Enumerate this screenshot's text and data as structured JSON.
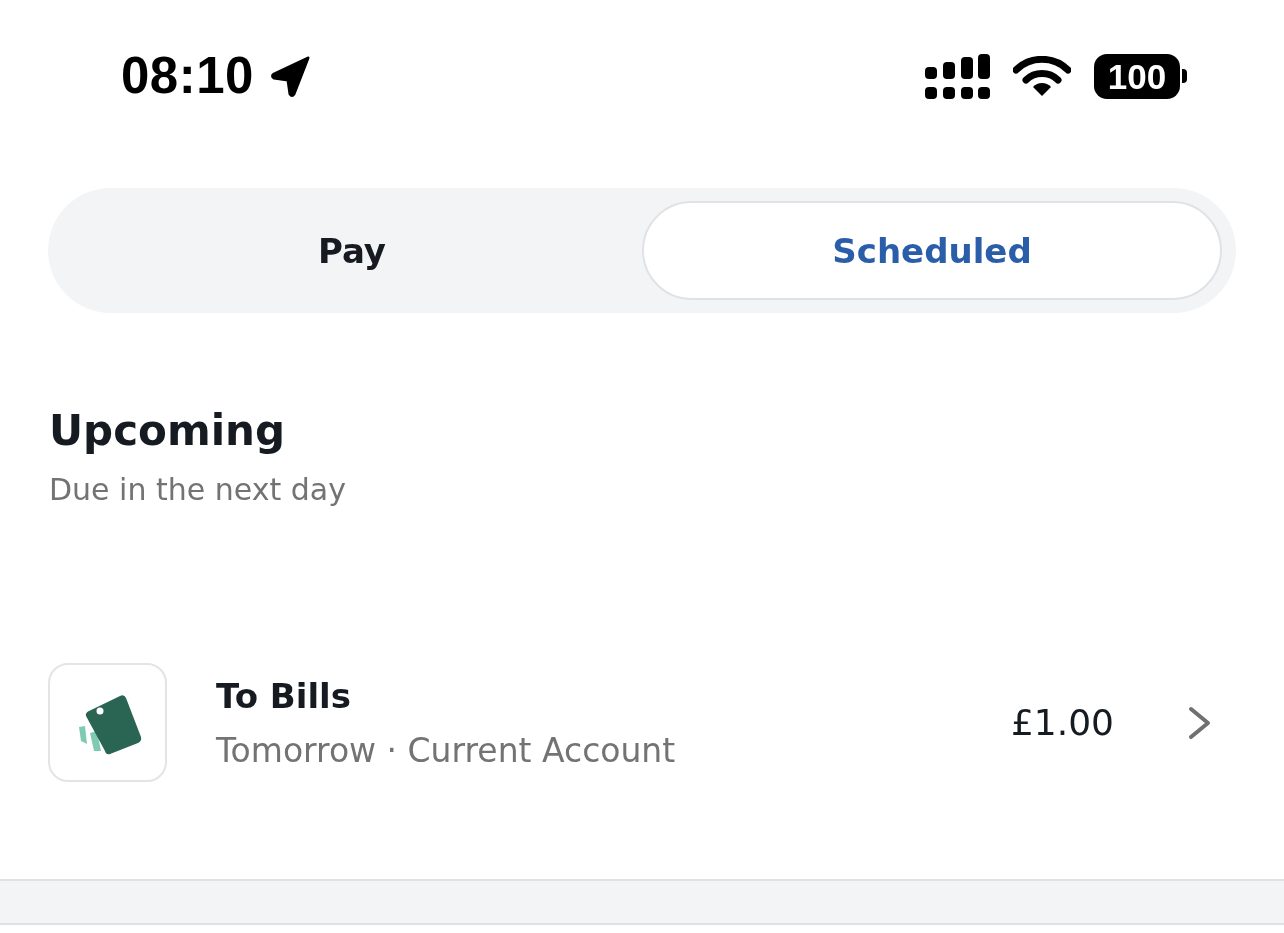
{
  "status_bar": {
    "time": "08:10",
    "battery": "100"
  },
  "tabs": [
    {
      "label": "Pay",
      "selected": false
    },
    {
      "label": "Scheduled",
      "selected": true
    }
  ],
  "section": {
    "title": "Upcoming",
    "subtitle": "Due in the next day"
  },
  "payments": [
    {
      "title": "To Bills",
      "subtitle": "Tomorrow · Current Account",
      "amount": "£1.00"
    }
  ]
}
